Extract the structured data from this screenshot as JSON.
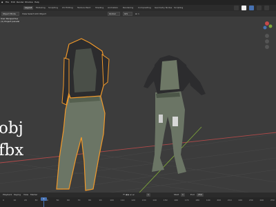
{
  "menu": {
    "items": [
      "File",
      "Edit",
      "Render",
      "Window",
      "Help"
    ]
  },
  "workspace_tabs": [
    {
      "label": "Layout",
      "active": true
    },
    {
      "label": "Modeling",
      "active": false
    },
    {
      "label": "Sculpting",
      "active": false
    },
    {
      "label": "UV Editing",
      "active": false
    },
    {
      "label": "Texture Paint",
      "active": false
    },
    {
      "label": "Shading",
      "active": false
    },
    {
      "label": "Animation",
      "active": false
    },
    {
      "label": "Rendering",
      "active": false
    },
    {
      "label": "Compositing",
      "active": false
    },
    {
      "label": "Geometry Nodes",
      "active": false
    },
    {
      "label": "Scripting",
      "active": false
    }
  ],
  "viewport_header": {
    "mode": "Object Mode",
    "menus": [
      "View",
      "Select",
      "Add",
      "Object"
    ],
    "transform": "Global",
    "pivot": "GIS",
    "select_mode": "Select Box"
  },
  "viewport_overlay": {
    "line1": "User Perspective",
    "line2": "(1) Project panelsl"
  },
  "formats": {
    "first": "obj",
    "second": "fbx"
  },
  "timeline": {
    "menus": [
      "Playback",
      "Keying",
      "View",
      "Marker"
    ],
    "current_frame": "1",
    "start_label": "Start",
    "start": "1",
    "end_label": "End",
    "end": "250",
    "ticks": [
      "0",
      "10",
      "20",
      "30",
      "40",
      "50",
      "60",
      "70",
      "80",
      "90",
      "100",
      "110",
      "120",
      "130",
      "140",
      "150",
      "160",
      "170",
      "180",
      "190",
      "200",
      "210",
      "220",
      "230",
      "240",
      "250"
    ]
  },
  "colors": {
    "accent": "#4772b3",
    "selection_outline": "#f39a2a",
    "jacket": "#2c2c2e",
    "pants": "#6b7565",
    "axis_x": "#c74a4a",
    "axis_y": "#7ea63a"
  },
  "icons": {
    "gizmo": "navigation-gizmo-icon",
    "viewport_shading": "shading-icon"
  }
}
